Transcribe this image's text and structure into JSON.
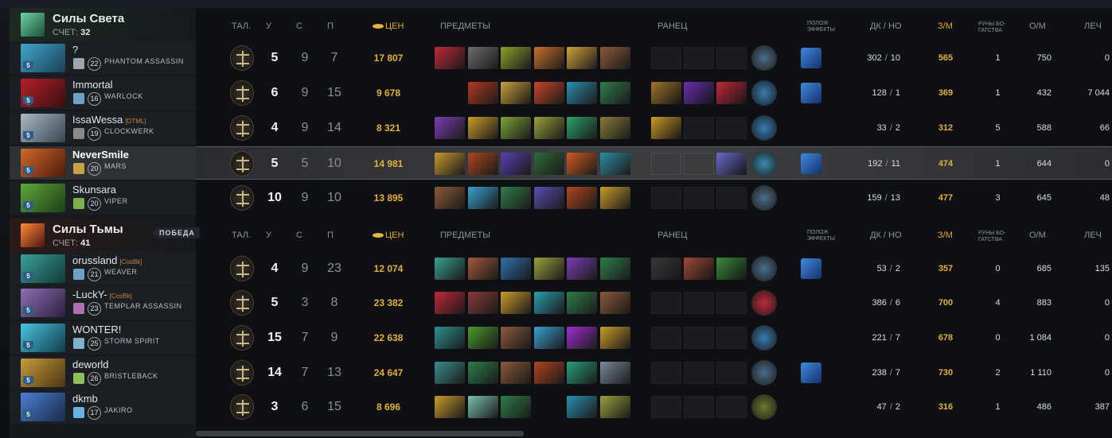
{
  "teams": {
    "radiant": {
      "name": "Силы Света",
      "score_label": "СЧЕТ:",
      "score": "32"
    },
    "dire": {
      "name": "Силы Тьмы",
      "score_label": "СЧЕТ:",
      "score": "41",
      "badge": "ПОБЕДА"
    }
  },
  "headers": {
    "talents": "ТАЛ.",
    "kills": "У",
    "deaths": "С",
    "assists": "П",
    "net": "ЦЕН",
    "items": "ПРЕДМЕТЫ",
    "backpack": "РАНЕЦ",
    "buffs_1": "ПОЛОЖ",
    "buffs_2": "ЭФФЕКТЫ",
    "lh": "ДК",
    "slash": "/",
    "dn": "НО",
    "gpm": "З/М",
    "runes_1": "РУНЫ БО-",
    "runes_1b": "ГАТСТВА",
    "xpm": "О/М",
    "heal": "ЛЕЧ",
    "runes_2": "РУНЫ БО-",
    "runes_2b": "ГАТСТВА"
  },
  "radiant_players": [
    {
      "name": "?",
      "tag": "",
      "level": "5",
      "hero_level": "22",
      "hero": "PHANTOM ASSASSIN",
      "k": "5",
      "d": "9",
      "a": "7",
      "net": "17 807",
      "lh": "302",
      "dn": "10",
      "gpm": "565",
      "runes": "1",
      "xpm": "750",
      "heal": "0"
    },
    {
      "name": "Immortal",
      "tag": "",
      "level": "5",
      "hero_level": "16",
      "hero": "WARLOCK",
      "k": "6",
      "d": "9",
      "a": "15",
      "net": "9 678",
      "lh": "128",
      "dn": "1",
      "gpm": "369",
      "runes": "1",
      "xpm": "432",
      "heal": "7 044"
    },
    {
      "name": "IssaWessa",
      "tag": "[DTML]",
      "level": "5",
      "hero_level": "19",
      "hero": "CLOCKWERK",
      "k": "4",
      "d": "9",
      "a": "14",
      "net": "8 321",
      "lh": "33",
      "dn": "2",
      "gpm": "312",
      "runes": "5",
      "xpm": "588",
      "heal": "66"
    },
    {
      "name": "NeverSmile",
      "tag": "",
      "level": "5",
      "hero_level": "20",
      "hero": "MARS",
      "k": "5",
      "d": "5",
      "a": "10",
      "net": "14 981",
      "lh": "192",
      "dn": "11",
      "gpm": "474",
      "runes": "1",
      "xpm": "644",
      "heal": "0"
    },
    {
      "name": "Skunsara",
      "tag": "",
      "level": "5",
      "hero_level": "20",
      "hero": "VIPER",
      "k": "10",
      "d": "9",
      "a": "10",
      "net": "13 895",
      "lh": "159",
      "dn": "13",
      "gpm": "477",
      "runes": "3",
      "xpm": "645",
      "heal": "48"
    }
  ],
  "dire_players": [
    {
      "name": "orussland",
      "tag": "[CosBk]",
      "level": "5",
      "hero_level": "21",
      "hero": "WEAVER",
      "k": "4",
      "d": "9",
      "a": "23",
      "net": "12 074",
      "lh": "53",
      "dn": "2",
      "gpm": "357",
      "runes": "0",
      "xpm": "685",
      "heal": "135"
    },
    {
      "name": "-LuckY-",
      "tag": "[CosBk]",
      "level": "5",
      "hero_level": "23",
      "hero": "TEMPLAR ASSASSIN",
      "k": "5",
      "d": "3",
      "a": "8",
      "net": "23 382",
      "lh": "386",
      "dn": "6",
      "gpm": "700",
      "runes": "4",
      "xpm": "883",
      "heal": "0"
    },
    {
      "name": "WONTER!",
      "tag": "",
      "level": "5",
      "hero_level": "25",
      "hero": "STORM SPIRIT",
      "k": "15",
      "d": "7",
      "a": "9",
      "net": "22 638",
      "lh": "221",
      "dn": "7",
      "gpm": "678",
      "runes": "0",
      "xpm": "1 084",
      "heal": "0"
    },
    {
      "name": "deworld",
      "tag": "",
      "level": "5",
      "hero_level": "26",
      "hero": "BRISTLEBACK",
      "k": "14",
      "d": "7",
      "a": "13",
      "net": "24 647",
      "lh": "238",
      "dn": "7",
      "gpm": "730",
      "runes": "2",
      "xpm": "1 110",
      "heal": "0"
    },
    {
      "name": "dkmb",
      "tag": "",
      "level": "5",
      "hero_level": "17",
      "hero": "JAKIRO",
      "k": "3",
      "d": "6",
      "a": "15",
      "net": "8 696",
      "lh": "47",
      "dn": "2",
      "gpm": "316",
      "runes": "1",
      "xpm": "486",
      "heal": "387"
    }
  ],
  "colors": {
    "gold": "#e2b03b",
    "radiant_accent": "#2d6a45",
    "dire_accent": "#8a2b1a"
  }
}
